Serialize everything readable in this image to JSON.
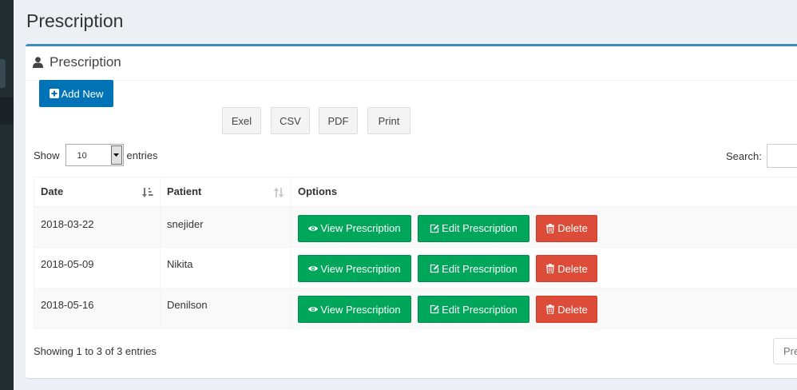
{
  "page": {
    "title": "Prescription"
  },
  "box": {
    "title": "Prescription",
    "add_new_label": "Add New"
  },
  "export_buttons": [
    "Exel",
    "CSV",
    "PDF",
    "Print"
  ],
  "table_controls": {
    "show_label": "Show",
    "length_value": "10",
    "entries_label": "entries",
    "search_label": "Search:",
    "search_value": ""
  },
  "table": {
    "columns": [
      "Date",
      "Patient",
      "Options"
    ],
    "rows": [
      {
        "date": "2018-03-22",
        "patient": "snejider"
      },
      {
        "date": "2018-05-09",
        "patient": "Nikita"
      },
      {
        "date": "2018-05-16",
        "patient": "Denilson"
      }
    ],
    "actions": {
      "view": "View Prescription",
      "edit": "Edit Prescription",
      "delete": "Delete"
    }
  },
  "footer": {
    "info": "Showing 1 to 3 of 3 entries",
    "previous_label": "Previous"
  },
  "colors": {
    "primary": "#3c8dbc",
    "add_button": "#0073b7",
    "success": "#00a65a",
    "danger": "#dd4b39",
    "sidebar": "#222d32",
    "background": "#ecf0f5"
  },
  "icons": {
    "header": "user-icon",
    "add": "plus-square-icon",
    "view": "eye-icon",
    "edit": "edit-icon",
    "delete": "trash-icon",
    "sort_active": "sort-amount-asc-icon",
    "sort_inactive": "sort-both-icon"
  }
}
